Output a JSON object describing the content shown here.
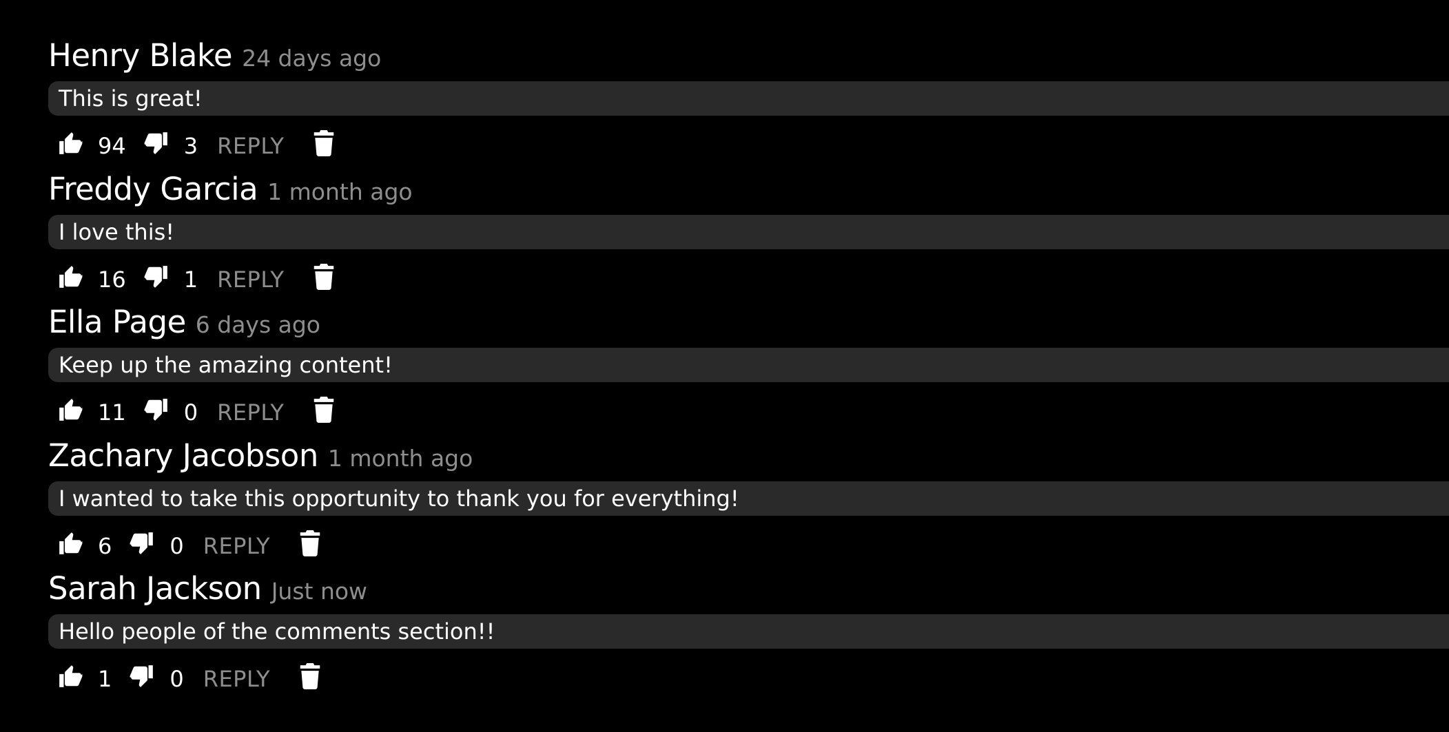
{
  "comments": [
    {
      "author": "Henry Blake",
      "timestamp": "24 days ago",
      "text": "This is great!",
      "likes": "94",
      "dislikes": "3",
      "reply_label": "REPLY"
    },
    {
      "author": "Freddy Garcia",
      "timestamp": "1 month ago",
      "text": "I love this!",
      "likes": "16",
      "dislikes": "1",
      "reply_label": "REPLY"
    },
    {
      "author": "Ella Page",
      "timestamp": "6 days ago",
      "text": "Keep up the amazing content!",
      "likes": "11",
      "dislikes": "0",
      "reply_label": "REPLY"
    },
    {
      "author": "Zachary Jacobson",
      "timestamp": "1 month ago",
      "text": "I wanted to take this opportunity to thank you for everything!",
      "likes": "6",
      "dislikes": "0",
      "reply_label": "REPLY"
    },
    {
      "author": "Sarah Jackson",
      "timestamp": "Just now",
      "text": "Hello people of the comments section!!",
      "likes": "1",
      "dislikes": "0",
      "reply_label": "REPLY"
    }
  ],
  "icons": {
    "like": "thumbs-up-icon",
    "dislike": "thumbs-down-icon",
    "delete": "trash-icon"
  },
  "colors": {
    "background": "#000000",
    "comment_body": "#2a2a2a",
    "text_primary": "#ffffff",
    "text_secondary": "#8e8e8e"
  }
}
